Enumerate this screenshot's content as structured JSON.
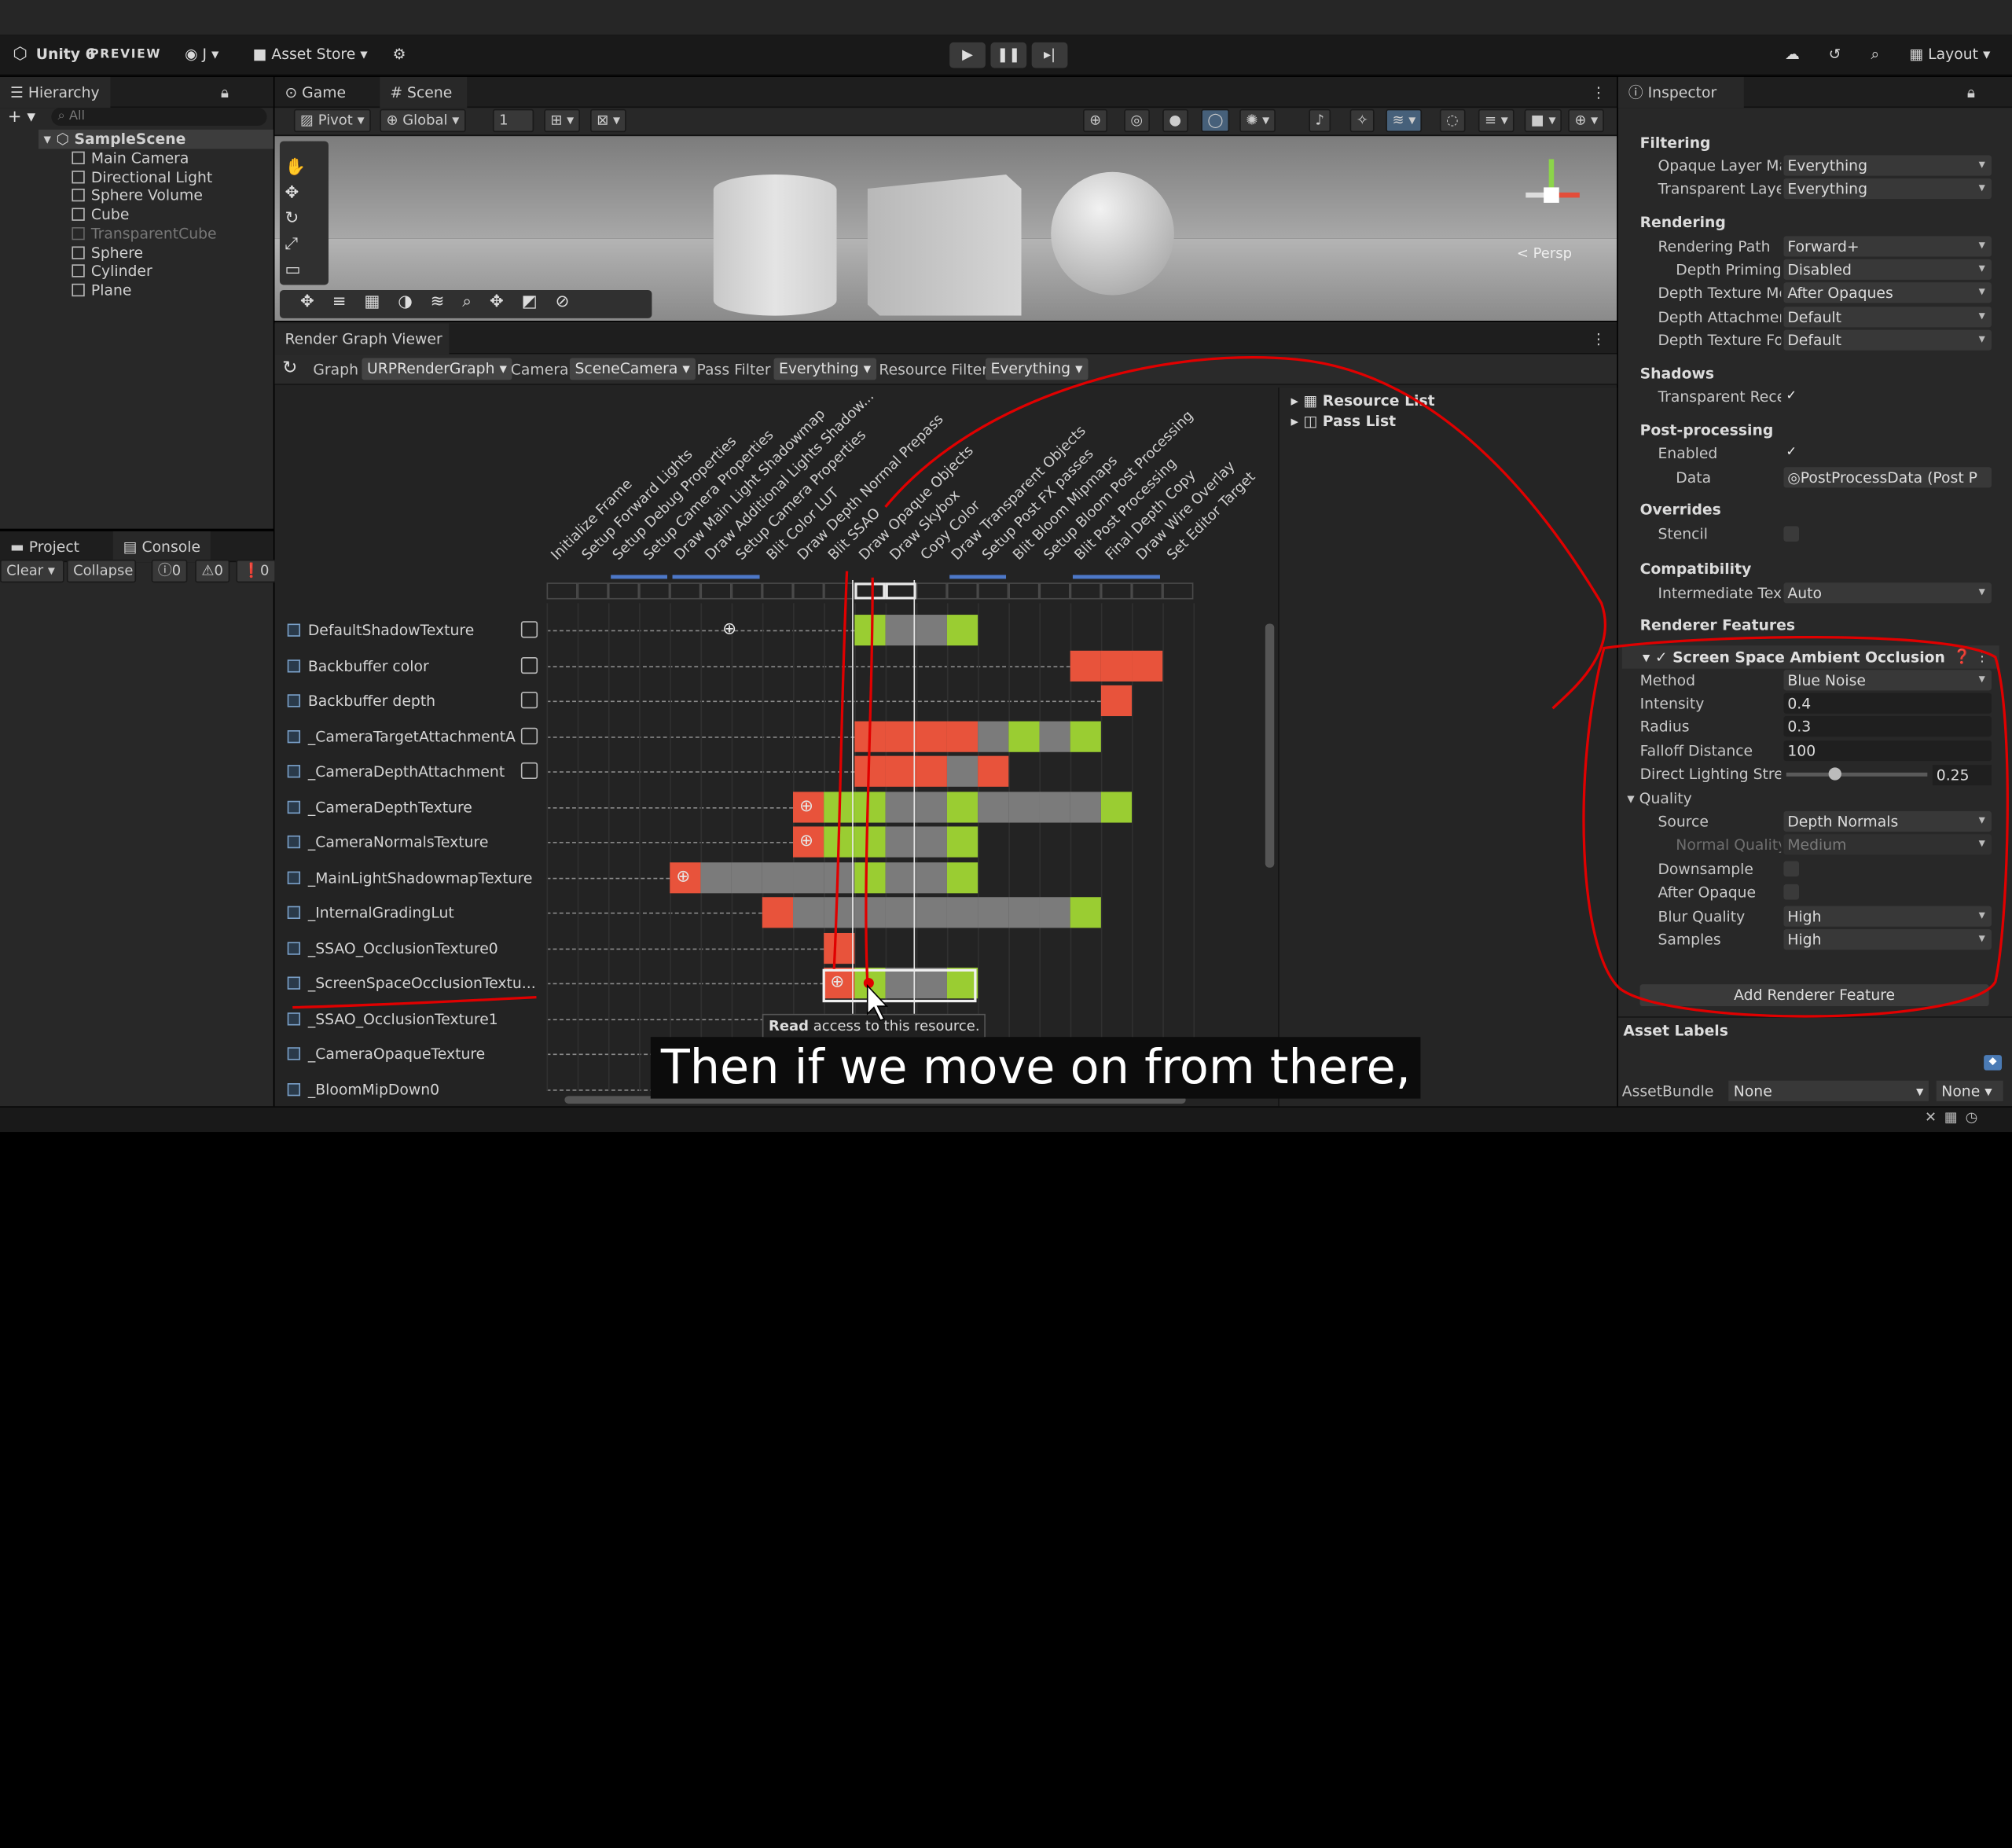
{
  "topbar": {
    "app_title": "Unity 6",
    "app_badge": "PREVIEW",
    "account": "J",
    "asset_store": "Asset Store",
    "layout": "Layout"
  },
  "hierarchy": {
    "tab": "Hierarchy",
    "search_placeholder": "All",
    "scene": "SampleScene",
    "items": [
      "Main Camera",
      "Directional Light",
      "Sphere Volume",
      "Cube",
      "TransparentCube",
      "Sphere",
      "Cylinder",
      "Plane"
    ]
  },
  "bottom_left": {
    "tabs": [
      "Project",
      "Console"
    ],
    "clear": "Clear",
    "collapse": "Collapse",
    "counts": [
      "0",
      "0",
      "0"
    ]
  },
  "scene_view": {
    "tabs": [
      "Game",
      "Scene"
    ],
    "pivot": "Pivot",
    "global": "Global",
    "grid_value": "1",
    "persp": "< Persp"
  },
  "render_graph": {
    "tab": "Render Graph Viewer",
    "graph_label": "Graph",
    "graph_value": "URPRenderGraph",
    "camera_label": "Camera",
    "camera_value": "SceneCamera",
    "pass_filter_label": "Pass Filter",
    "pass_filter_value": "Everything",
    "resource_filter_label": "Resource Filter",
    "resource_filter_value": "Everything",
    "resource_list": "Resource List",
    "pass_list": "Pass List",
    "passes": [
      "Initialize Frame",
      "Setup Forward Lights",
      "Setup Debug Properties",
      "Setup Camera Properties",
      "Draw Main Light Shadowmap",
      "Draw Additional Lights Shadow...",
      "Setup Camera Properties",
      "Blit Color LUT",
      "Draw Depth Normal Prepass",
      "Blit SSAO",
      "Draw Opaque Objects",
      "Draw Skybox",
      "Copy Color",
      "Draw Transparent Objects",
      "Setup Post FX passes",
      "Blit Bloom Mipmaps",
      "Setup Bloom Post Processing",
      "Blit Post Processing",
      "Final Depth Copy",
      "Draw Wire Overlay",
      "Set Editor Target"
    ],
    "resources": [
      "DefaultShadowTexture",
      "Backbuffer color",
      "Backbuffer depth",
      "_CameraTargetAttachmentA",
      "_CameraDepthAttachment",
      "_CameraDepthTexture",
      "_CameraNormalsTexture",
      "_MainLightShadowmapTexture",
      "_InternalGradingLut",
      "_SSAO_OcclusionTexture0",
      "_ScreenSpaceOcclusionTextu...",
      "_SSAO_OcclusionTexture1",
      "_CameraOpaqueTexture",
      "_BloomMipDown0"
    ],
    "tooltip_bold": "Read",
    "tooltip_rest": " access to this resource."
  },
  "inspector": {
    "tab": "Inspector",
    "filtering": "Filtering",
    "opaque_layer_label": "Opaque Layer Mas",
    "opaque_layer_value": "Everything",
    "transparent_layer_label": "Transparent Layer",
    "transparent_layer_value": "Everything",
    "rendering": "Rendering",
    "rendering_path_label": "Rendering Path",
    "rendering_path_value": "Forward+",
    "depth_priming_label": "Depth Priming M",
    "depth_priming_value": "Disabled",
    "depth_texture_mode_label": "Depth Texture Mo",
    "depth_texture_mode_value": "After Opaques",
    "depth_attachment_label": "Depth Attachment",
    "depth_attachment_value": "Default",
    "depth_texture_format_label": "Depth Texture For",
    "depth_texture_format_value": "Default",
    "shadows": "Shadows",
    "transparent_receive_label": "Transparent Recei",
    "post_processing": "Post-processing",
    "enabled_label": "Enabled",
    "data_label": "Data",
    "data_value": "PostProcessData (Post P",
    "overrides": "Overrides",
    "stencil_label": "Stencil",
    "compatibility": "Compatibility",
    "intermediate_label": "Intermediate Textu",
    "intermediate_value": "Auto",
    "renderer_features": "Renderer Features",
    "ssao_title": "Screen Space Ambient Occlusion",
    "method_label": "Method",
    "method_value": "Blue Noise",
    "intensity_label": "Intensity",
    "intensity_value": "0.4",
    "radius_label": "Radius",
    "radius_value": "0.3",
    "falloff_label": "Falloff Distance",
    "falloff_value": "100",
    "direct_label": "Direct Lighting Stren",
    "direct_value": "0.25",
    "direct_fraction": 0.25,
    "quality": "Quality",
    "source_label": "Source",
    "source_value": "Depth Normals",
    "normal_quality_label": "Normal Quality",
    "normal_quality_value": "Medium",
    "downsample_label": "Downsample",
    "after_opaque_label": "After Opaque",
    "blur_quality_label": "Blur Quality",
    "blur_quality_value": "High",
    "samples_label": "Samples",
    "samples_value": "High",
    "add_feature": "Add Renderer Feature",
    "asset_labels": "Asset Labels",
    "asset_bundle_label": "AssetBundle",
    "asset_bundle_value": "None",
    "asset_bundle_variant": "None"
  },
  "subtitle": "Then if we move on from there,",
  "colors": {
    "write": "#e8533b",
    "read": "#9acd32",
    "unused": "#7b7b7b",
    "annotation": "#e00000"
  }
}
